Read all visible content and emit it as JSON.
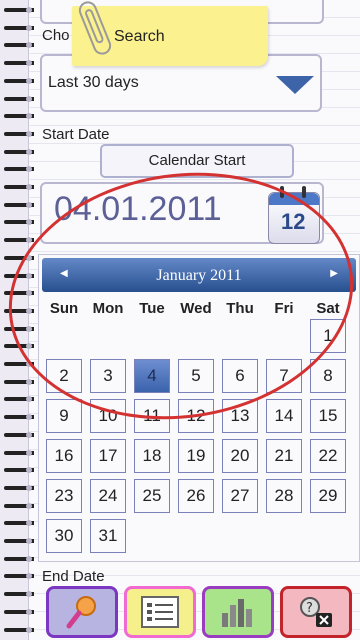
{
  "form": {
    "top_label_partial": "Cho",
    "sticky_note": "Search",
    "range_value": "Last 30 days",
    "start_date_label": "Start Date",
    "calendar_start_button": "Calendar Start",
    "start_date_value": "04.01.2011",
    "calendar_icon_day": "12",
    "end_date_label": "End Date"
  },
  "calendar": {
    "month_title": "January 2011",
    "prev_glyph": "◀",
    "next_glyph": "▶",
    "weekdays": [
      "Sun",
      "Mon",
      "Tue",
      "Wed",
      "Thu",
      "Fri",
      "Sat"
    ],
    "first_weekday_index": 6,
    "days_in_month": 31,
    "selected_day": 4
  },
  "tabbar": {
    "tabs": [
      "search-tab",
      "list-tab",
      "chart-tab",
      "help-close-tab"
    ]
  },
  "colors": {
    "accent_blue": "#3d64a8",
    "annotation_red": "#d43131",
    "sticky_yellow": "#fbf18e"
  }
}
